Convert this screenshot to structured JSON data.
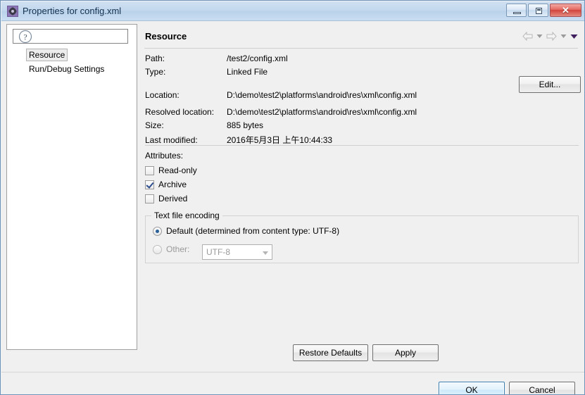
{
  "window": {
    "title": "Properties for config.xml",
    "icon": "properties-gear-icon",
    "controls": {
      "minimize": "Minimize",
      "maximize": "Maximize",
      "close": "Close",
      "close_glyph": "✕"
    }
  },
  "sidebar": {
    "filter": {
      "value": "",
      "placeholder": ""
    },
    "items": [
      {
        "label": "Resource",
        "selected": true
      },
      {
        "label": "Run/Debug Settings",
        "selected": false
      }
    ]
  },
  "page": {
    "title": "Resource",
    "nav": {
      "back": "back-arrow",
      "back_menu": "back-dropdown",
      "forward": "forward-arrow",
      "forward_menu": "forward-dropdown",
      "menu": "view-menu"
    },
    "properties": [
      {
        "label": "Path:",
        "value": "/test2/config.xml"
      },
      {
        "label": "Type:",
        "value": "Linked File"
      },
      {
        "label": "Location:",
        "value": "D:\\demo\\test2\\platforms\\android\\res\\xml\\config.xml"
      },
      {
        "label": "Resolved location:",
        "value": "D:\\demo\\test2\\platforms\\android\\res\\xml\\config.xml"
      },
      {
        "label": "Size:",
        "value": "885  bytes"
      },
      {
        "label": "Last modified:",
        "value": "2016年5月3日 上午10:44:33"
      }
    ],
    "edit_button": "Edit...",
    "attributes": {
      "label": "Attributes:",
      "items": [
        {
          "label": "Read-only",
          "checked": false
        },
        {
          "label": "Archive",
          "checked": true
        },
        {
          "label": "Derived",
          "checked": false
        }
      ]
    },
    "encoding": {
      "group_title": "Text file encoding",
      "default_label": "Default (determined from content type: UTF-8)",
      "default_selected": true,
      "other_label": "Other:",
      "other_selected": false,
      "other_value": "UTF-8",
      "other_enabled": false
    },
    "restore_defaults": "Restore Defaults",
    "apply": "Apply"
  },
  "footer": {
    "help": "?",
    "ok": "OK",
    "cancel": "Cancel"
  },
  "colors": {
    "title_bar_start": "#cfe0f1",
    "title_bar_end": "#cadef2",
    "dialog_bg": "#f0f0f0",
    "close_button": "#d1443c",
    "primary_border": "#3c7fb1",
    "window_border": "#6d94bb",
    "accent_purple": "#8b77b5"
  }
}
